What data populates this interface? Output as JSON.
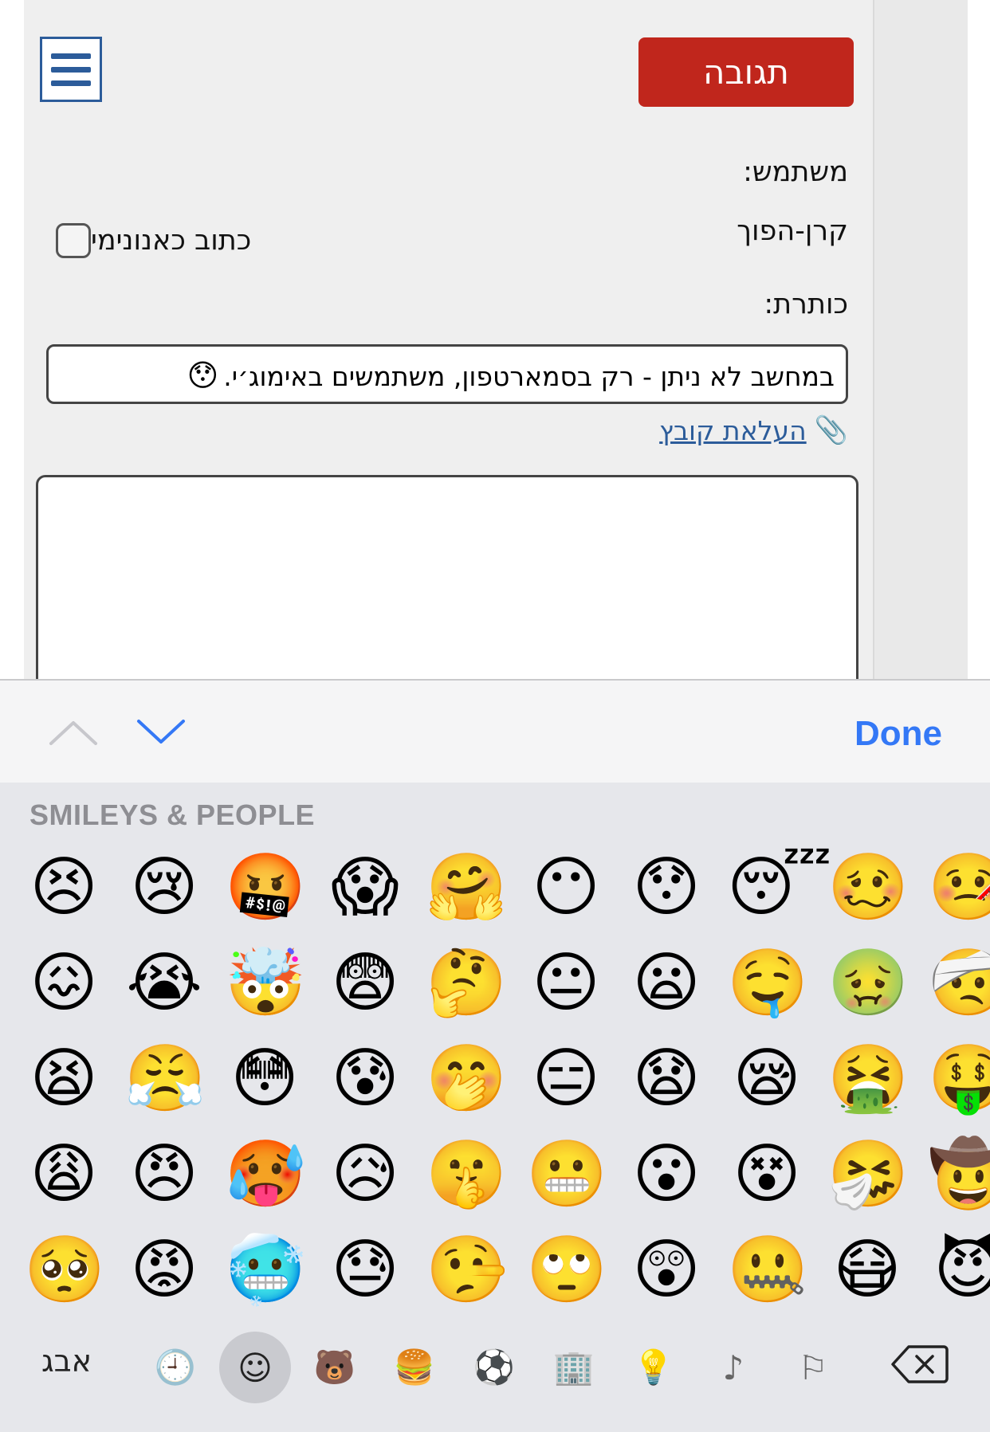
{
  "header": {
    "reply_label": "תגובה"
  },
  "form": {
    "user_label": "משתמש:",
    "user_name": "קרן-הפוך",
    "anonymous_label": "כתוב כאנונימי",
    "title_label": "כותרת:",
    "subject_value": "במחשב לא ניתן - רק בסמארטפון, משתמשים באימוג׳י.",
    "subject_emoji": "😯",
    "upload_label": "העלאת קובץ",
    "body_value": ""
  },
  "accessory": {
    "done_label": "Done"
  },
  "keyboard": {
    "category_title": "SMILEYS & PEOPLE",
    "rows": [
      [
        "😣",
        "😢",
        "🤬",
        "😱",
        "🤗",
        "😶",
        "😯",
        "😴",
        "🥴",
        "🤒"
      ],
      [
        "😖",
        "😭",
        "🤯",
        "😨",
        "🤔",
        "😐",
        "😦",
        "🤤",
        "🤢",
        "🤕"
      ],
      [
        "😫",
        "😤",
        "😳",
        "😰",
        "🤭",
        "😑",
        "😧",
        "😪",
        "🤮",
        "🤑"
      ],
      [
        "😩",
        "😠",
        "🥵",
        "😥",
        "🤫",
        "😬",
        "😮",
        "😵",
        "🤧",
        "🤠"
      ],
      [
        "🥺",
        "😡",
        "🥶",
        "😓",
        "🤥",
        "🙄",
        "😲",
        "🤐",
        "😷",
        "😈"
      ]
    ],
    "abc_label": "אבג",
    "category_icons": [
      {
        "name": "recent-icon",
        "glyph": "🕘"
      },
      {
        "name": "smileys-icon",
        "glyph": "☺"
      },
      {
        "name": "animals-icon",
        "glyph": "🐻"
      },
      {
        "name": "food-icon",
        "glyph": "🍔"
      },
      {
        "name": "activity-icon",
        "glyph": "⚽"
      },
      {
        "name": "travel-icon",
        "glyph": "🏢"
      },
      {
        "name": "objects-icon",
        "glyph": "💡"
      },
      {
        "name": "symbols-icon",
        "glyph": "♪"
      },
      {
        "name": "flags-icon",
        "glyph": "⚐"
      }
    ]
  }
}
